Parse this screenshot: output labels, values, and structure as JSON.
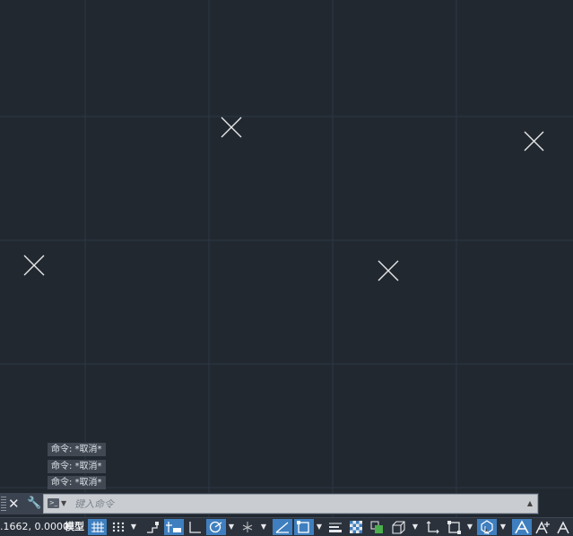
{
  "command_history": [
    "命令: *取消*",
    "命令: *取消*",
    "命令: *取消*"
  ],
  "command_line": {
    "placeholder": "键入命令",
    "close_icon": "close-icon",
    "customize_icon": "wrench-icon",
    "prompt_icon": "command-prompt-icon"
  },
  "status_bar": {
    "coordinates": ".1662, 0.0000",
    "model_label": "模型",
    "buttons": [
      {
        "name": "grid-display-icon",
        "active": true
      },
      {
        "name": "snap-mode-icon",
        "active": false
      },
      {
        "name": "infer-constraints-icon",
        "active": false
      },
      {
        "name": "dynamic-input-icon",
        "active": true
      },
      {
        "name": "ortho-mode-icon",
        "active": false
      },
      {
        "name": "polar-tracking-icon",
        "active": true
      },
      {
        "name": "isometric-drafting-icon",
        "active": false
      },
      {
        "name": "object-snap-tracking-icon",
        "active": true
      },
      {
        "name": "object-snap-icon",
        "active": true
      },
      {
        "name": "lineweight-icon",
        "active": false
      },
      {
        "name": "transparency-icon",
        "active": false
      },
      {
        "name": "selection-cycling-icon",
        "active": false
      },
      {
        "name": "3d-object-snap-icon",
        "active": false
      },
      {
        "name": "dynamic-ucs-icon",
        "active": false
      },
      {
        "name": "selection-filter-icon",
        "active": false
      },
      {
        "name": "gizmo-icon",
        "active": true
      },
      {
        "name": "annotation-visibility-icon",
        "active": true
      },
      {
        "name": "auto-scale-icon",
        "active": false
      },
      {
        "name": "annotation-scale-icon",
        "active": false
      }
    ]
  },
  "colors": {
    "canvas_background": "#212830",
    "grid_line": "#2d3744",
    "active_button": "#3f7fbf",
    "point_marker": "#e6e6e6"
  }
}
